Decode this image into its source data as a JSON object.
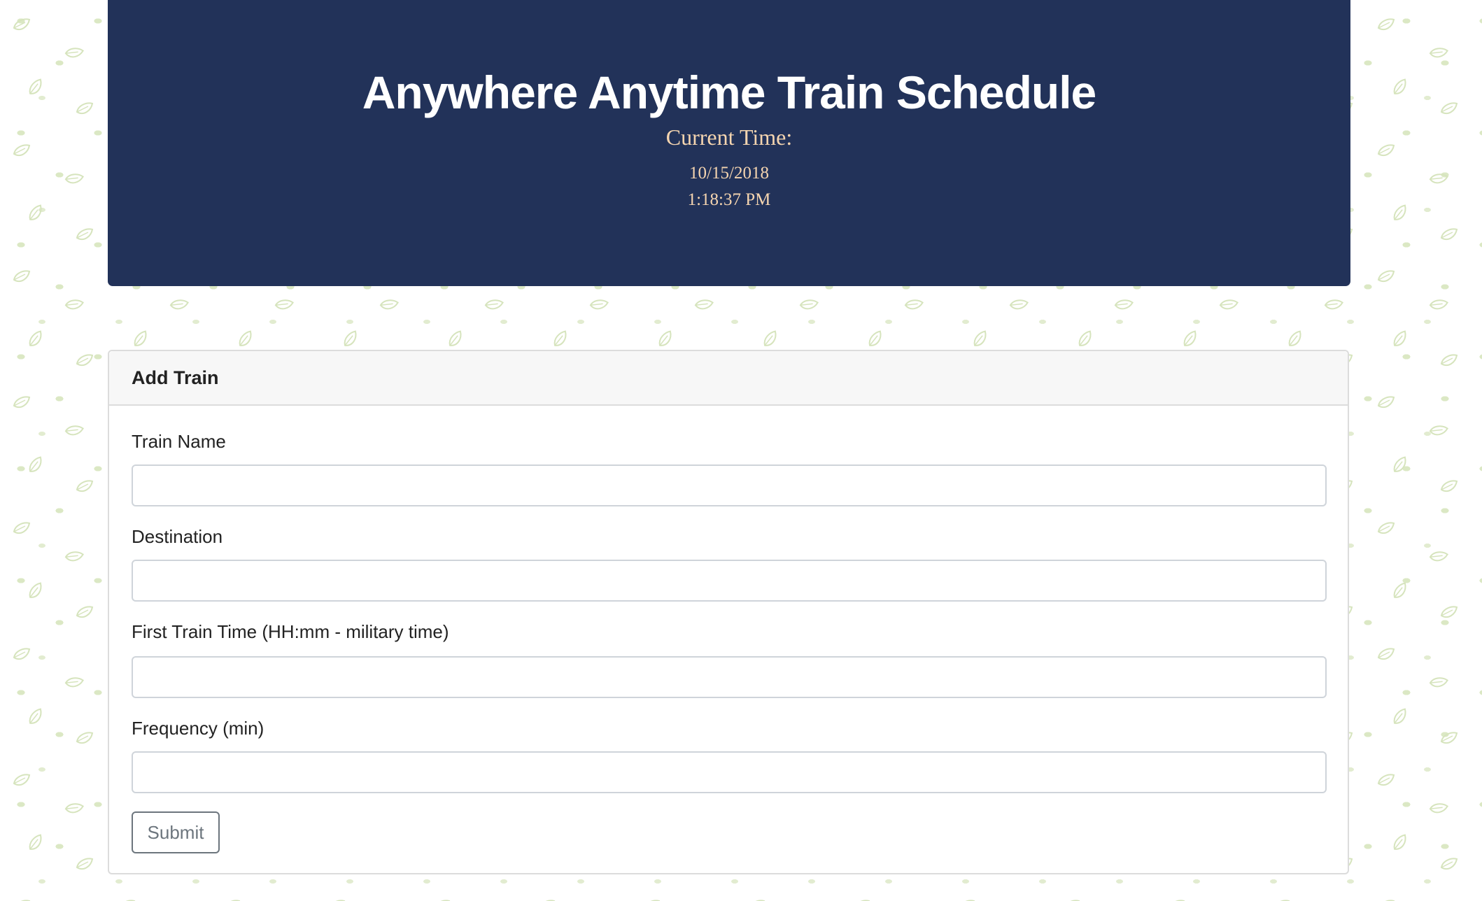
{
  "header": {
    "title": "Anywhere Anytime Train Schedule",
    "current_time_label": "Current Time:",
    "date": "10/15/2018",
    "time": "1:18:37 PM"
  },
  "form": {
    "title": "Add Train",
    "fields": [
      {
        "label": "Train Name",
        "value": "",
        "placeholder": ""
      },
      {
        "label": "Destination",
        "value": "",
        "placeholder": ""
      },
      {
        "label": "First Train Time (HH:mm - military time)",
        "value": "",
        "placeholder": ""
      },
      {
        "label": "Frequency (min)",
        "value": "",
        "placeholder": ""
      }
    ],
    "submit_label": "Submit"
  },
  "colors": {
    "header_bg": "#223259",
    "accent_text": "#f5d5b0",
    "background_pattern": "leaf-icon"
  }
}
